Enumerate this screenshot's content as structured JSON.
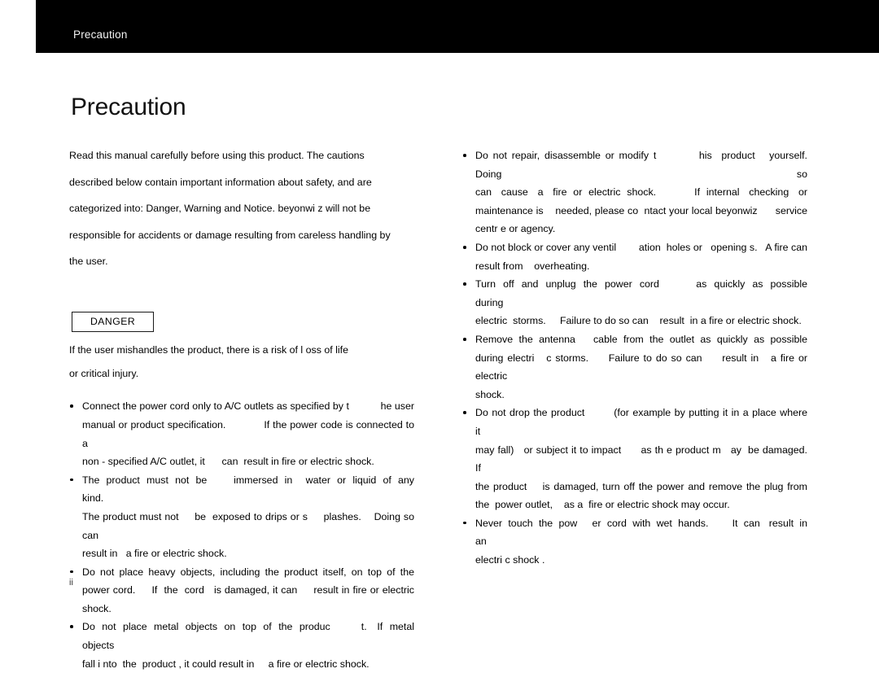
{
  "header": {
    "running_title": "Precaution",
    "background_color": "#000000",
    "text_color": "#f2f2f2"
  },
  "page": {
    "title": "Precaution",
    "folio": "ii"
  },
  "intro": {
    "lines": [
      "Read  this  manual  carefully  before  using  this  product.             The  cautions",
      "described  below  contain  important  information  about  safety,  and  are",
      "categorized  into:  Danger,  Warning  and  Notice.              beyonwi z  will  not  be",
      "responsible    for accidents or damage resulting from careless            handling by",
      "the user."
    ]
  },
  "danger": {
    "label": "DANGER",
    "description_lines": [
      "If the user mishandles the product, there is a risk of l                    oss of life",
      "or  critical injury."
    ]
  },
  "left_column": {
    "bullets": [
      {
        "lines": [
          "Connect the power cord only to A/C outlets as specified by t           he user",
          "manual or product specification.            If the power code is connected to a",
          "non - specified A/C outlet, it      can  result in fire or electric shock."
        ]
      },
      {
        "lines": [
          "The  product  must  not  be        immersed  in    water  or  liquid  of  any  kind.",
          "The product must not     be  exposed to drips or s     plashes.    Doing so can",
          "result in   a fire or electric shock."
        ]
      },
      {
        "lines": [
          "Do not place heavy objects, including the product itself, on top of the",
          "power cord.     If  the  cord   is damaged, it can     result in fire or electric",
          "shock."
        ]
      },
      {
        "lines": [
          "Do  not  place  metal  objects  on  top  of  the  produc         t.   If  metal  objects",
          "fall i nto  the  product , it could result in     a fire or electric shock."
        ]
      }
    ]
  },
  "right_column": {
    "bullets": [
      {
        "lines": [
          "Do not repair, disassemble or modify t         his  product   yourself.     Doing so",
          "can   cause   a   fire  or  electric  shock.            If  internal   checking   or",
          "maintenance is    needed, please co  ntact your local beyonwiz      service",
          "centr e or agency."
        ]
      },
      {
        "lines": [
          "Do not block or cover any ventil        ation  holes or   opening s.   A fire can",
          "result from    overheating."
        ]
      },
      {
        "lines": [
          "Turn  off  and  unplug  the  power  cord          as  quickly  as  possible  during",
          "electric  storms.     Failure to do so can    result  in a fire or electric shock."
        ]
      },
      {
        "lines": [
          "Remove  the  antenna      cable  from  the  outlet  as  quickly  as  possible",
          "during electri   c storms.     Failure to do so can     result in   a fire or electric",
          "shock."
        ]
      },
      {
        "lines": [
          "Do not drop the product        (for example by putting it in a place where           it",
          "may fall)   or subject it to impact      as th e product m   ay  be damaged.     If",
          "the product    is damaged, turn off the power and remove the plug from",
          "the  power outlet,    as a  fire or electric shock may occur."
        ]
      },
      {
        "lines": [
          "Never  touch  the  pow     er  cord  with  wet  hands.        It  can   result  in  an",
          "electri c shock ."
        ]
      }
    ]
  }
}
